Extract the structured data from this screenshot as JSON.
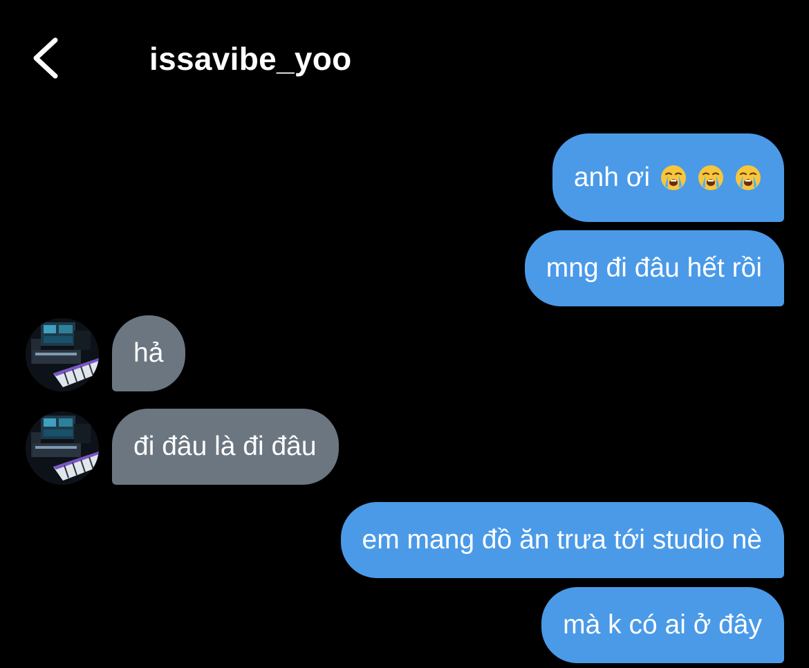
{
  "header": {
    "username": "issavibe_yoo",
    "back_icon": "chevron-left-icon"
  },
  "messages": [
    {
      "side": "sent",
      "text": "anh ơi",
      "emojis": [
        "loudly-crying-face",
        "loudly-crying-face",
        "loudly-crying-face"
      ]
    },
    {
      "side": "sent",
      "text": "mng đi đâu hết rồi"
    },
    {
      "side": "received",
      "text": "hả"
    },
    {
      "side": "received",
      "text": "đi đâu là đi đâu"
    },
    {
      "side": "sent",
      "text": "em mang đồ ăn trưa tới studio nè"
    },
    {
      "side": "sent",
      "text": "mà k có ai ở đây"
    }
  ],
  "colors": {
    "background": "#000000",
    "sent_bubble": "#4a9ae8",
    "received_bubble": "#6b7681",
    "text": "#ffffff"
  }
}
